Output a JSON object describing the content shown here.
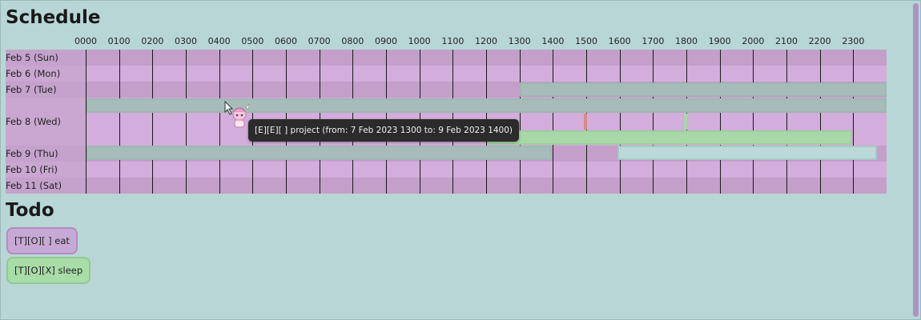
{
  "schedule": {
    "title": "Schedule",
    "hours": [
      "0000",
      "0100",
      "0200",
      "0300",
      "0400",
      "0500",
      "0600",
      "0700",
      "0800",
      "0900",
      "1000",
      "1100",
      "1200",
      "1300",
      "1400",
      "1500",
      "1600",
      "1700",
      "1800",
      "1900",
      "2000",
      "2100",
      "2200",
      "2300"
    ],
    "days": [
      "Feb 5 (Sun)",
      "Feb 6 (Mon)",
      "Feb 7 (Tue)",
      "Feb 8 (Wed)",
      "Feb 9 (Thu)",
      "Feb 10 (Fri)",
      "Feb 11 (Sat)"
    ],
    "tooltip": "[E][E][ ] project (from: 7 Feb 2023 1300 to: 9 Feb 2023 1400)"
  },
  "todo": {
    "title": "Todo",
    "items": [
      {
        "label": "[T][O][ ] eat",
        "color": "#c8a9d6"
      },
      {
        "label": "[T][O][X] sleep",
        "color": "#a8dca8"
      }
    ]
  },
  "colors": {
    "background": "#b9d6d6",
    "row_odd": "#c39fca",
    "row_even": "#d3addb",
    "event_gray": "#a7bcb8",
    "event_green": "#a8d8a8",
    "event_light": "#bcd9d9",
    "marker_red": "#d98a8a",
    "marker_green": "#a8d8a8",
    "scrollbar": "#aa94c2"
  }
}
